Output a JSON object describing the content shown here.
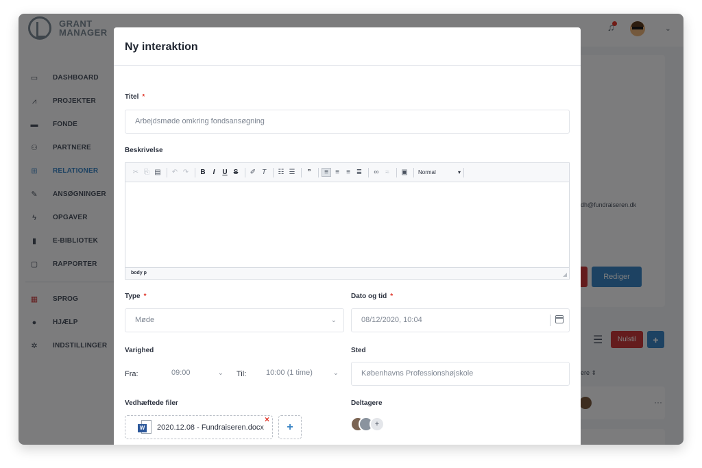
{
  "app": {
    "logo_line1": "GRANT",
    "logo_line2": "MANAGER"
  },
  "sidebar": {
    "items": [
      {
        "label": "DASHBOARD",
        "icon": "dashboard-icon"
      },
      {
        "label": "PROJEKTER",
        "icon": "chart-icon"
      },
      {
        "label": "FONDE",
        "icon": "wallet-icon"
      },
      {
        "label": "PARTNERE",
        "icon": "people-icon"
      },
      {
        "label": "RELATIONER",
        "icon": "network-icon",
        "active": true
      },
      {
        "label": "ANSØGNINGER",
        "icon": "edit-icon"
      },
      {
        "label": "OPGAVER",
        "icon": "bolt-icon"
      },
      {
        "label": "E-BIBLIOTEK",
        "icon": "book-icon"
      },
      {
        "label": "RAPPORTER",
        "icon": "monitor-icon"
      },
      {
        "label": "SPROG",
        "icon": "flag-icon"
      },
      {
        "label": "HJÆLP",
        "icon": "info-icon"
      },
      {
        "label": "INDSTILLINGER",
        "icon": "gear-icon"
      }
    ]
  },
  "background": {
    "email": "dh@fundraiseren.dk",
    "edit_button": "Rediger",
    "reset_button": "Nulstil",
    "add_button": "+",
    "sort_label": "ere ⇕",
    "row_menu": "···"
  },
  "modal": {
    "title": "Ny interaktion",
    "title_field": {
      "label": "Titel",
      "required_mark": "*",
      "value": "Arbejdsmøde omkring fondsansøgning"
    },
    "description": {
      "label": "Beskrivelse",
      "format": "Normal",
      "status_path": "body  p"
    },
    "type": {
      "label": "Type",
      "required_mark": "*",
      "value": "Møde"
    },
    "datetime": {
      "label": "Dato og tid",
      "required_mark": "*",
      "value": "08/12/2020, 10:04"
    },
    "duration": {
      "label": "Varighed",
      "from_label": "Fra:",
      "from_value": "09:00",
      "to_label": "Til:",
      "to_value": "10:00 (1 time)"
    },
    "location": {
      "label": "Sted",
      "value": "Københavns Professionshøjskole"
    },
    "attachments": {
      "label": "Vedhæftede filer",
      "file_name": "2020.12.08 - Fundraiseren.docx",
      "file_type_badge": "W",
      "remove": "×",
      "add": "+"
    },
    "participants": {
      "label": "Deltagere",
      "add": "+"
    }
  },
  "colors": {
    "accent": "#3a84c4",
    "danger": "#c9383a",
    "required": "#e0382c",
    "word": "#2b579a"
  }
}
